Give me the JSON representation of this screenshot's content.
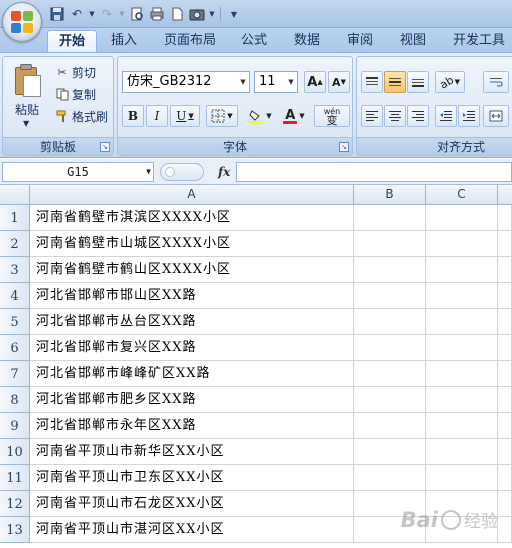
{
  "ribbon": {
    "tabs": [
      {
        "label": "开始",
        "active": true
      },
      {
        "label": "插入"
      },
      {
        "label": "页面布局"
      },
      {
        "label": "公式"
      },
      {
        "label": "数据"
      },
      {
        "label": "审阅"
      },
      {
        "label": "视图"
      },
      {
        "label": "开发工具"
      }
    ],
    "clipboard": {
      "paste": "粘贴",
      "cut": "剪切",
      "copy": "复制",
      "format_painter": "格式刷",
      "group_label": "剪贴板"
    },
    "font": {
      "font_name": "仿宋_GB2312",
      "font_size": "11",
      "group_label": "字体",
      "bold": "B",
      "italic": "I",
      "underline": "U",
      "grow_font": "A",
      "shrink_font": "A",
      "font_color_letter": "A",
      "phonetic": "wén"
    },
    "alignment": {
      "group_label": "对齐方式"
    }
  },
  "formula_bar": {
    "name_box": "G15",
    "fx_label": "fx",
    "formula": ""
  },
  "sheet": {
    "columns": [
      "A",
      "B",
      "C"
    ],
    "rows": [
      {
        "num": "1",
        "a": "河南省鹤壁市淇滨区XXXX小区"
      },
      {
        "num": "2",
        "a": "河南省鹤壁市山城区XXXX小区"
      },
      {
        "num": "3",
        "a": "河南省鹤壁市鹤山区XXXX小区"
      },
      {
        "num": "4",
        "a": "河北省邯郸市邯山区XX路"
      },
      {
        "num": "5",
        "a": "河北省邯郸市丛台区XX路"
      },
      {
        "num": "6",
        "a": "河北省邯郸市复兴区XX路"
      },
      {
        "num": "7",
        "a": "河北省邯郸市峰峰矿区XX路"
      },
      {
        "num": "8",
        "a": "河北省邯郸市肥乡区XX路"
      },
      {
        "num": "9",
        "a": "河北省邯郸市永年区XX路"
      },
      {
        "num": "10",
        "a": "河南省平顶山市新华区XX小区"
      },
      {
        "num": "11",
        "a": "河南省平顶山市卫东区XX小区"
      },
      {
        "num": "12",
        "a": "河南省平顶山市石龙区XX小区"
      },
      {
        "num": "13",
        "a": "河南省平顶山市湛河区XX小区"
      }
    ]
  },
  "watermark": {
    "left": "Bai",
    "right": "经验"
  },
  "colors": {
    "ribbon_bg": "#dde8f6",
    "tab_active_bg": "#ffffff",
    "highlight_yellow": "#f8c66a",
    "font_color_red": "#e02020",
    "fill_yellow": "#ffff00",
    "grid_line": "#d4d4d4"
  }
}
